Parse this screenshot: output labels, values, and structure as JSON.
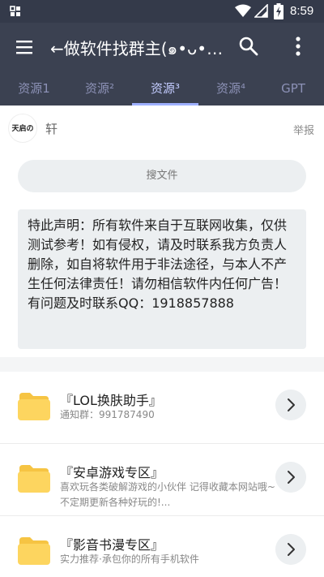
{
  "status_bar": {
    "time": "8:59"
  },
  "app_bar": {
    "title": "←做软件找群主(๑•ᴗ•๑)..."
  },
  "tabs": [
    {
      "label": "资源1"
    },
    {
      "label": "资源²"
    },
    {
      "label": "资源³"
    },
    {
      "label": "资源⁴"
    },
    {
      "label": "GPT"
    }
  ],
  "author": {
    "name": "轩",
    "avatar_text": "天启の咩",
    "report_label": "举报"
  },
  "search": {
    "label": "搜文件"
  },
  "notice": {
    "text": "特此声明：所有软件来自于互联网收集，仅供测试参考！如有侵权，请及时联系我方负责人删除，如自将软件用于非法途径，与本人不产生任何法律责任！请勿相信软件内任何广告！有问题及时联系QQ：1918857888"
  },
  "items": [
    {
      "title": "『LOL换肤助手』",
      "desc": "通知群：991787490"
    },
    {
      "title": "『安卓游戏专区』",
      "desc": "喜欢玩各类破解游戏的小伙伴 记得收藏本网站哦~不定期更新各种好玩的!..."
    },
    {
      "title": "『影音书漫专区』",
      "desc": "实力推荐·承包你的所有手机软件"
    }
  ],
  "colors": {
    "app_bar": "#3b4151",
    "status_bar": "#343a4a",
    "tab_active": "#c3ccff",
    "tab_inactive": "#8c91b6",
    "folder": "#fdd55f"
  }
}
